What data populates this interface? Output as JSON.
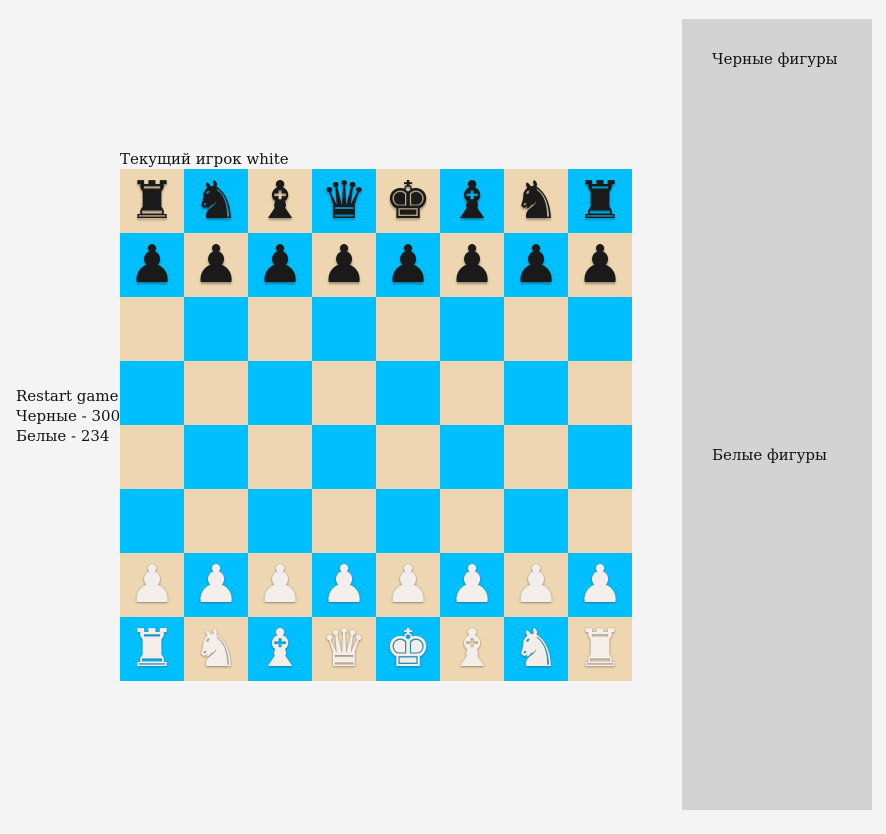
{
  "game": {
    "current_player_label": "Текущий игрок white",
    "restart_label": "Restart game",
    "black_score": "Черные - 300",
    "white_score": "Белые - 234"
  },
  "side_panel": {
    "black_title": "Черные фигуры",
    "white_title": "Белые фигуры"
  },
  "colors": {
    "light_square": "#eed6b0",
    "dark_square": "#00bfff",
    "panel": "#d3d3d3",
    "background": "#f4f4f4"
  },
  "board": {
    "rows": [
      [
        "br",
        "bn",
        "bb",
        "bq",
        "bk",
        "bb",
        "bn",
        "br"
      ],
      [
        "bp",
        "bp",
        "bp",
        "bp",
        "bp",
        "bp",
        "bp",
        "bp"
      ],
      [
        "",
        "",
        "",
        "",
        "",
        "",
        "",
        ""
      ],
      [
        "",
        "",
        "",
        "",
        "",
        "",
        "",
        ""
      ],
      [
        "",
        "",
        "",
        "",
        "",
        "",
        "",
        ""
      ],
      [
        "",
        "",
        "",
        "",
        "",
        "",
        "",
        ""
      ],
      [
        "wp",
        "wp",
        "wp",
        "wp",
        "wp",
        "wp",
        "wp",
        "wp"
      ],
      [
        "wr",
        "wn",
        "wb",
        "wq",
        "wk",
        "wb",
        "wn",
        "wr"
      ]
    ]
  }
}
